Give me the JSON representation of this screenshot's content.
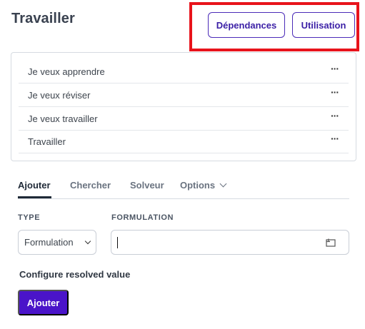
{
  "page": {
    "title": "Travailler"
  },
  "header_buttons": {
    "dependencies": "Dépendances",
    "usage": "Utilisation"
  },
  "list": {
    "items": [
      {
        "label": "Je veux apprendre",
        "menu": "···"
      },
      {
        "label": "Je veux réviser",
        "menu": "···"
      },
      {
        "label": "Je veux travailler",
        "menu": "···"
      },
      {
        "label": "Travailler",
        "menu": "···"
      }
    ]
  },
  "tabs": [
    {
      "label": "Ajouter",
      "active": true
    },
    {
      "label": "Chercher",
      "active": false
    },
    {
      "label": "Solveur",
      "active": false
    },
    {
      "label": "Options",
      "active": false,
      "icon": "chevron-down-icon"
    }
  ],
  "form": {
    "type_label": "TYPE",
    "type_value": "Formulation",
    "formulation_label": "FORMULATION",
    "formulation_value": "",
    "input_icon": "expand-field-icon"
  },
  "config_text": "Configure resolved value",
  "submit_label": "Ajouter",
  "colors": {
    "accent": "#4a14c9",
    "highlight": "#e8131b",
    "border": "#d6dbe1"
  }
}
